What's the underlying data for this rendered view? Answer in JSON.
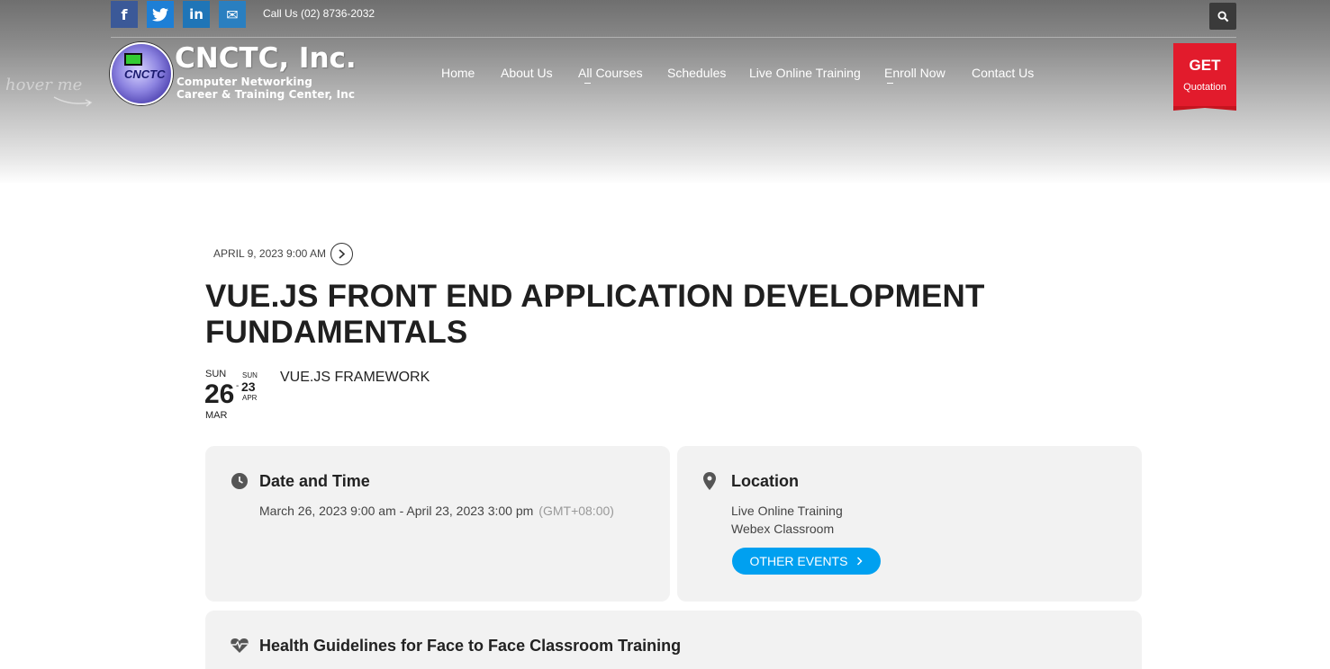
{
  "topbar": {
    "social": [
      {
        "name": "facebook",
        "glyph": "f"
      },
      {
        "name": "twitter",
        "glyph": "t"
      },
      {
        "name": "linkedin",
        "glyph": "in"
      },
      {
        "name": "email",
        "glyph": "✉"
      }
    ],
    "call_text": "Call Us (02) 8736-2032"
  },
  "hover_hint": "hover me",
  "brand": {
    "name": "CNCTC, Inc.",
    "subtitle_line1": "Computer Networking",
    "subtitle_line2": "Career & Training Center, Inc",
    "logo_text": "CNCTC"
  },
  "nav": {
    "items": [
      {
        "label": "Home"
      },
      {
        "label": "About Us"
      },
      {
        "label": "All Courses"
      },
      {
        "label": "Schedules"
      },
      {
        "label": "Live Online Training"
      },
      {
        "label": "Enroll Now"
      },
      {
        "label": "Contact Us"
      }
    ]
  },
  "quote": {
    "get": "GET",
    "label": "Quotation",
    "color": "#e21b2c"
  },
  "event": {
    "date_line": "APRIL 9, 2023 9:00 AM",
    "title": "VUE.JS FRONT END APPLICATION DEVELOPMENT FUNDAMENTALS",
    "start": {
      "weekday": "SUN",
      "day": "26",
      "month": "MAR"
    },
    "end": {
      "weekday": "SUN",
      "day": "23",
      "month": "APR"
    },
    "separator": "-",
    "category": "VUE.JS FRAMEWORK"
  },
  "date_time_card": {
    "title": "Date and Time",
    "range": "March 26, 2023 9:00 am - April 23, 2023 3:00 pm",
    "timezone": "(GMT+08:00)"
  },
  "location_card": {
    "title": "Location",
    "line1": "Live Online Training",
    "line2": "Webex Classroom",
    "button_label": "OTHER EVENTS",
    "button_color": "#00a0f0"
  },
  "health_card": {
    "title": "Health Guidelines for Face to Face Classroom Training"
  }
}
